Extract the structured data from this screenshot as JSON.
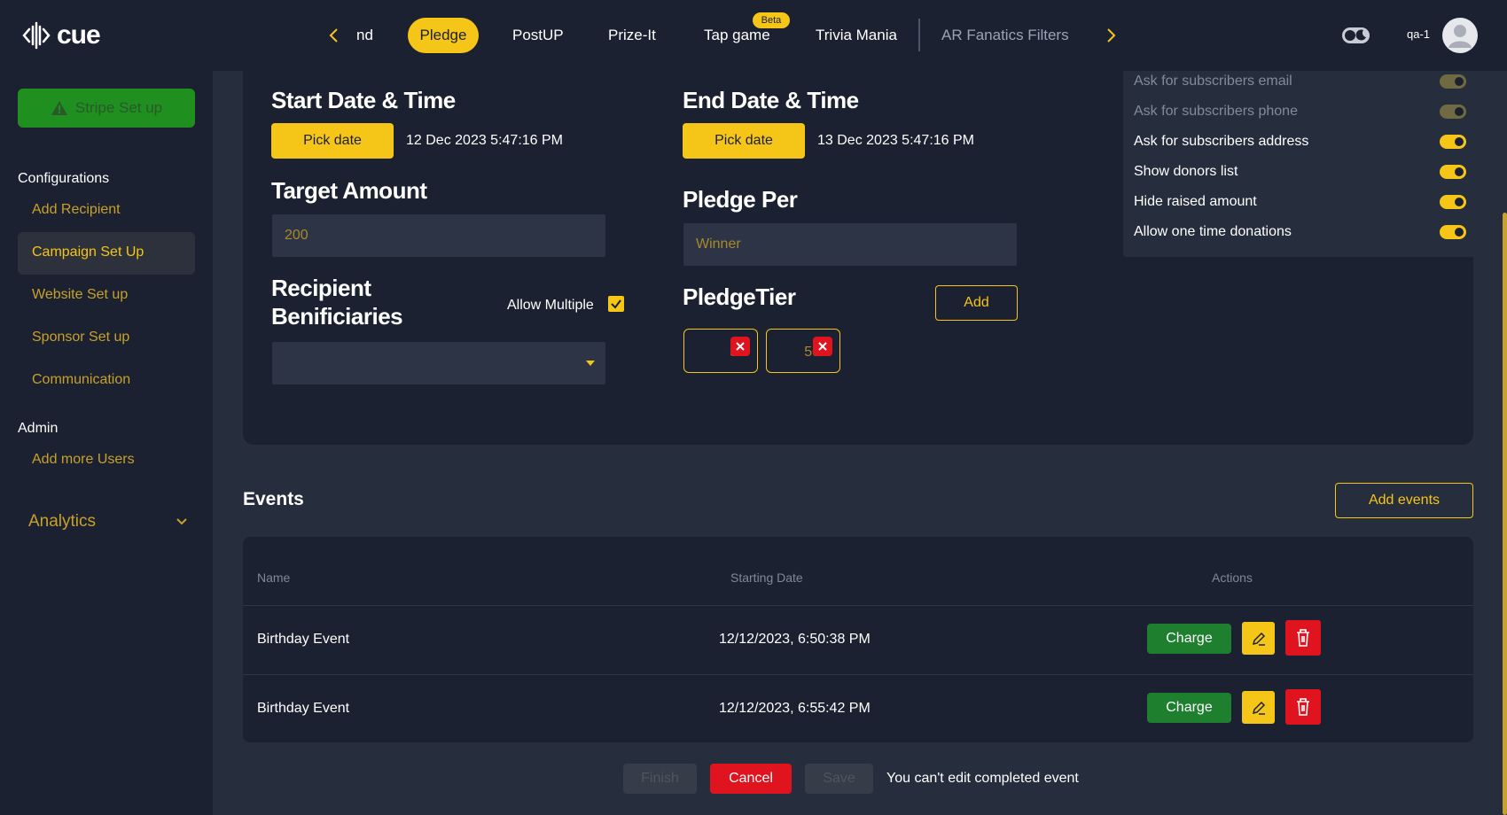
{
  "app": {
    "logo_text": "cue"
  },
  "nav": {
    "tabs": [
      {
        "label": "nd"
      },
      {
        "label": "Pledge"
      },
      {
        "label": "PostUP"
      },
      {
        "label": "Prize-It"
      },
      {
        "label": "Tap game",
        "badge": "Beta"
      },
      {
        "label": "Trivia Mania"
      },
      {
        "label": "AR Fanatics Filters"
      }
    ],
    "active_tab": "Pledge",
    "username": "qa-1"
  },
  "sidebar": {
    "stripe_label": "Stripe Set up",
    "configurations_heading": "Configurations",
    "items": [
      {
        "label": "Add Recipient"
      },
      {
        "label": "Campaign Set Up"
      },
      {
        "label": "Website Set up"
      },
      {
        "label": "Sponsor Set up"
      },
      {
        "label": "Communication"
      }
    ],
    "admin_heading": "Admin",
    "admin_items": [
      {
        "label": "Add more Users"
      }
    ],
    "analytics_label": "Analytics"
  },
  "form": {
    "start_title": "Start Date & Time",
    "start_pick_label": "Pick date",
    "start_value": "12 Dec 2023 5:47:16 PM",
    "end_title": "End Date & Time",
    "end_pick_label": "Pick date",
    "end_value": "13 Dec 2023 5:47:16 PM",
    "target_title": "Target Amount",
    "target_value": "200",
    "pledge_per_title": "Pledge Per",
    "pledge_per_value": "Winner",
    "recipient_title_1": "Recipient",
    "recipient_title_2": "Benificiaries",
    "allow_multiple_label": "Allow Multiple",
    "allow_multiple_checked": true,
    "pledge_tier_title": "PledgeTier",
    "add_tier_label": "Add",
    "tiers": [
      "5",
      "50"
    ]
  },
  "settings": [
    {
      "label": "Ask for subscribers email",
      "enabled": false
    },
    {
      "label": "Ask for subscribers phone",
      "enabled": false
    },
    {
      "label": "Ask for subscribers address",
      "enabled": true
    },
    {
      "label": "Show donors list",
      "enabled": true
    },
    {
      "label": "Hide raised amount",
      "enabled": true
    },
    {
      "label": "Allow one time donations",
      "enabled": true
    }
  ],
  "events": {
    "title": "Events",
    "add_label": "Add events",
    "columns": [
      "Name",
      "Starting Date",
      "Actions"
    ],
    "rows": [
      {
        "name": "Birthday Event",
        "date": "12/12/2023, 6:50:38 PM",
        "charge_label": "Charge"
      },
      {
        "name": "Birthday Event",
        "date": "12/12/2023, 6:55:42 PM",
        "charge_label": "Charge"
      }
    ]
  },
  "footer": {
    "finish_label": "Finish",
    "cancel_label": "Cancel",
    "save_label": "Save",
    "message": "You can't edit completed event"
  },
  "colors": {
    "accent": "#f5c518",
    "danger": "#e0141e",
    "success": "#1e7f2e",
    "background": "#1b2130"
  }
}
